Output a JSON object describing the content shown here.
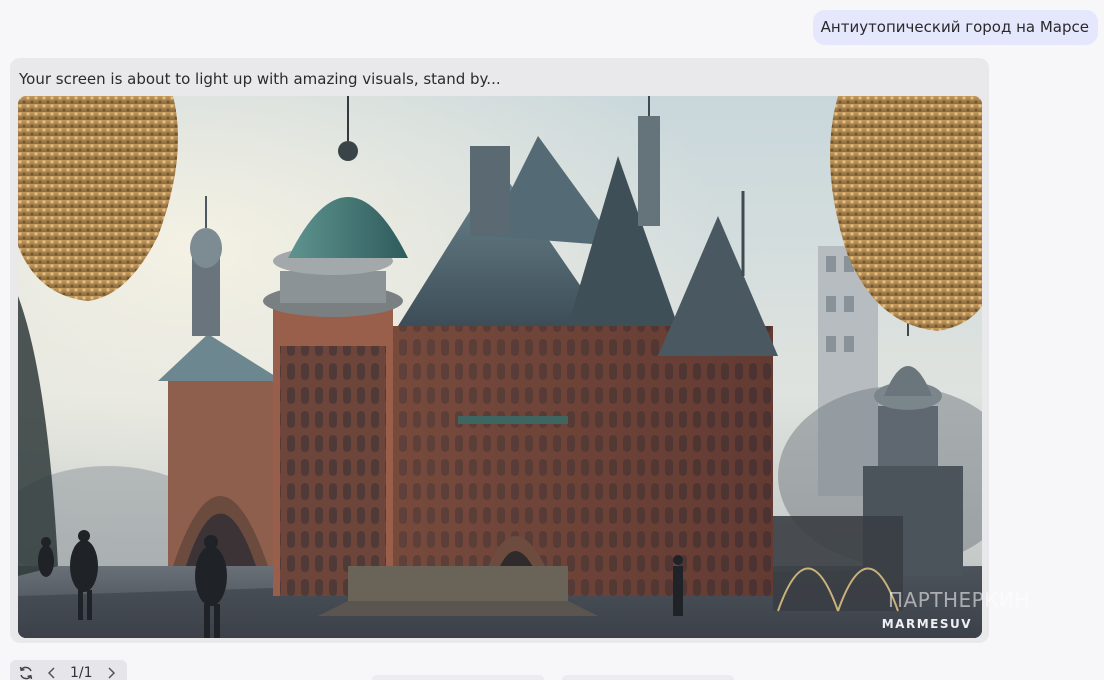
{
  "user_message": {
    "text": "Антиутопический город на Марсе"
  },
  "bot_message": {
    "text": "Your screen is about to light up with amazing visuals, stand by...",
    "image": {
      "watermark": "MARMESUV",
      "ghost_watermark": "ПАРТНЕРКИН"
    }
  },
  "controls": {
    "regenerate_icon": "refresh-icon",
    "prev_icon": "chevron-left-icon",
    "next_icon": "chevron-right-icon",
    "page_indicator": "1/1"
  }
}
